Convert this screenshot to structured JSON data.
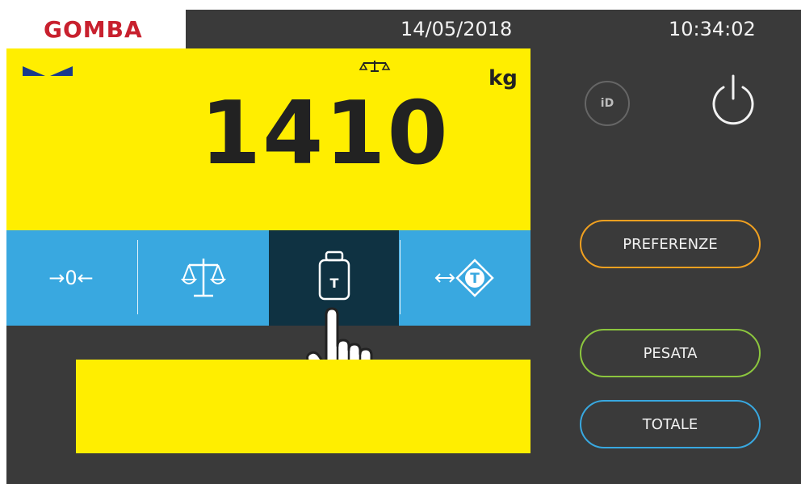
{
  "header": {
    "brand": "GOMBA",
    "date": "14/05/2018",
    "time": "10:34:02"
  },
  "weight": {
    "value": "1410",
    "unit": "kg"
  },
  "function_bar": {
    "zero_label": "→0←",
    "tare_glyph": "T",
    "preset_tare_glyph": "T",
    "active_button": "tare"
  },
  "side": {
    "id_label": "iD",
    "preferences_label": "PREFERENZE",
    "weighing_label": "PESATA",
    "total_label": "TOTALE"
  },
  "colors": {
    "panel_yellow": "#ffee00",
    "bar_blue": "#39a8e0",
    "active_dark": "#0f3242",
    "brand_red": "#c8202e",
    "pref_orange": "#f0a020",
    "pesata_green": "#8cc63e",
    "totale_blue": "#38a8e0"
  },
  "icons": [
    "stable-indicator-icon",
    "balance-icon",
    "scale-icon",
    "tare-weight-icon",
    "preset-tare-icon",
    "power-icon",
    "pointing-hand-icon"
  ]
}
